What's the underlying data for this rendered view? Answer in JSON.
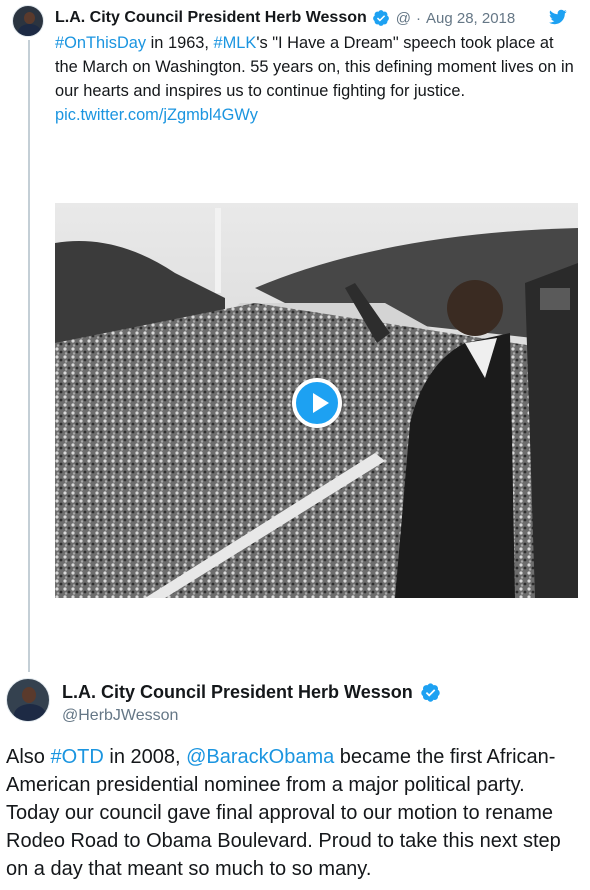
{
  "tweet1": {
    "display_name": "L.A. City Council President Herb Wesson",
    "handle": "@",
    "separator": "·",
    "date": "Aug 28, 2018",
    "text_parts": {
      "hashtag_otd": "#OnThisDay",
      "t1": " in 1963, ",
      "hashtag_mlk": "#MLK",
      "t2": "'s \"I Have a Dream\" speech took place at the March on Washington. 55 years on, this defining moment lives on in our hearts and inspires us to continue fighting for justice. ",
      "pic_link": "pic.twitter.com/jZgmbl4GWy"
    },
    "media": {
      "type": "video",
      "play_icon": "play-icon"
    }
  },
  "tweet2": {
    "display_name": "L.A. City Council President Herb Wesson",
    "handle": "@HerbJWesson",
    "text_parts": {
      "t0": "Also ",
      "hashtag_otd": "#OTD",
      "t1": " in 2008, ",
      "mention": "@BarackObama",
      "t2": " became the first African-American presidential nominee from a major political party. Today our council gave final approval to our motion to rename Rodeo Road to Obama Boulevard. Proud to take this next step on a day that meant so much to so many."
    }
  },
  "colors": {
    "link": "#1b95e0",
    "brand": "#1da1f2",
    "secondary_text": "#657786"
  },
  "icons": {
    "verified": "verified-badge-icon",
    "twitter": "twitter-bird-icon"
  }
}
